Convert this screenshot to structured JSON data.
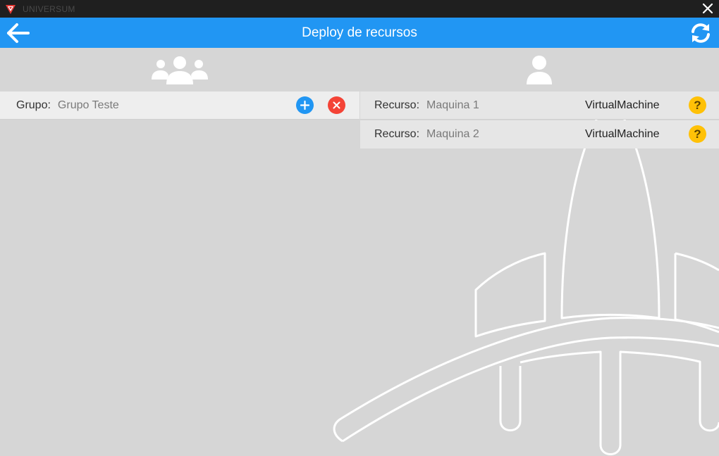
{
  "window": {
    "app_name": "UNIVERSUM",
    "logo_icon": "universum-logo-icon",
    "close_icon": "close-icon"
  },
  "appbar": {
    "title": "Deploy de recursos",
    "back_icon": "arrow-left-icon",
    "refresh_icon": "refresh-icon",
    "color": "#2196f3"
  },
  "groups_panel": {
    "icon": "users-group-icon",
    "items": [
      {
        "label": "Grupo:",
        "value": "Grupo Teste",
        "add_icon": "plus-icon",
        "delete_icon": "close-icon"
      }
    ]
  },
  "resources_panel": {
    "icon": "user-icon",
    "items": [
      {
        "label": "Recurso:",
        "value": "Maquina 1",
        "type": "VirtualMachine",
        "help": "?"
      },
      {
        "label": "Recurso:",
        "value": "Maquina 2",
        "type": "VirtualMachine",
        "help": "?"
      }
    ]
  },
  "colors": {
    "add": "#2196f3",
    "delete": "#f44336",
    "help": "#ffc107",
    "background": "#d6d6d6"
  }
}
